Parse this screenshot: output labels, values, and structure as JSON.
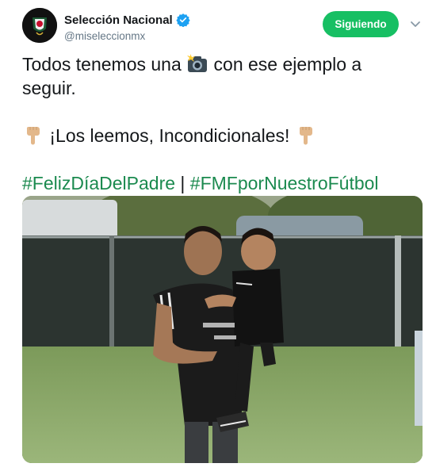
{
  "account": {
    "display_name": "Selección Nacional",
    "handle": "@miseleccionmx",
    "verified": true,
    "avatar_icon": "fmf-crest-icon"
  },
  "follow_button": {
    "label": "Siguiendo",
    "color": "#17bf63"
  },
  "menu": {
    "icon": "chevron-down-icon"
  },
  "tweet": {
    "line1_prefix": "Todos tenemos una",
    "line1_emoji": "camera-flash-icon",
    "line1_suffix": "con ese ejemplo a",
    "line2": "seguir.",
    "line3_emoji_left": "pointing-down-hand-icon",
    "line3_text": "¡Los leemos, Incondicionales!",
    "line3_emoji_right": "pointing-down-hand-icon",
    "hashtag1": "#FelizDíaDelPadre",
    "separator": "|",
    "hashtag2": "#FMFporNuestroFútbol",
    "hashtag_color": "#1b8a4f"
  },
  "media": {
    "description_icon": "photo-father-and-son-icon"
  }
}
